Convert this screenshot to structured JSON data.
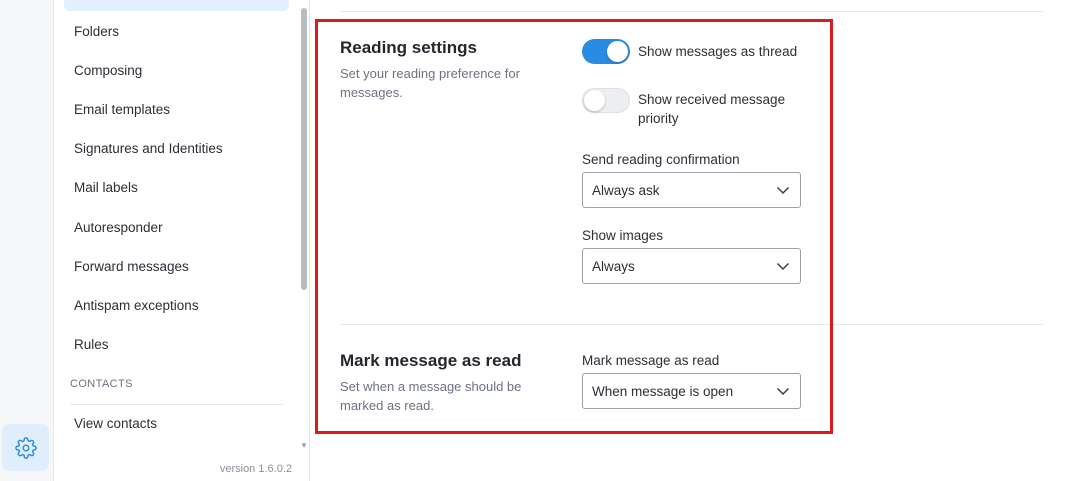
{
  "nav": {
    "items": [
      {
        "label": "Folders"
      },
      {
        "label": "Composing"
      },
      {
        "label": "Email templates"
      },
      {
        "label": "Signatures and Identities"
      },
      {
        "label": "Mail labels"
      },
      {
        "label": "Autoresponder"
      },
      {
        "label": "Forward messages"
      },
      {
        "label": "Antispam exceptions"
      },
      {
        "label": "Rules"
      }
    ],
    "contacts_heading": "CONTACTS",
    "contacts_items": [
      {
        "label": "View contacts"
      }
    ],
    "version": "version 1.6.0.2"
  },
  "reading": {
    "title": "Reading settings",
    "description": "Set your reading preference for messages.",
    "thread_toggle": {
      "label": "Show messages as thread",
      "on": true
    },
    "priority_toggle": {
      "label": "Show received message priority",
      "on": false
    },
    "confirmation": {
      "label": "Send reading confirmation",
      "value": "Always ask"
    },
    "images": {
      "label": "Show images",
      "value": "Always"
    }
  },
  "mark_read": {
    "title": "Mark message as read",
    "description": "Set when a message should be marked as read.",
    "field": {
      "label": "Mark message as read",
      "value": "When message is open"
    }
  },
  "colors": {
    "accent": "#2a8be3",
    "highlight": "#d81c1c",
    "active_nav": "#e3effc"
  },
  "icons": {
    "settings": "gear-icon",
    "select": "chevron-down-icon"
  }
}
